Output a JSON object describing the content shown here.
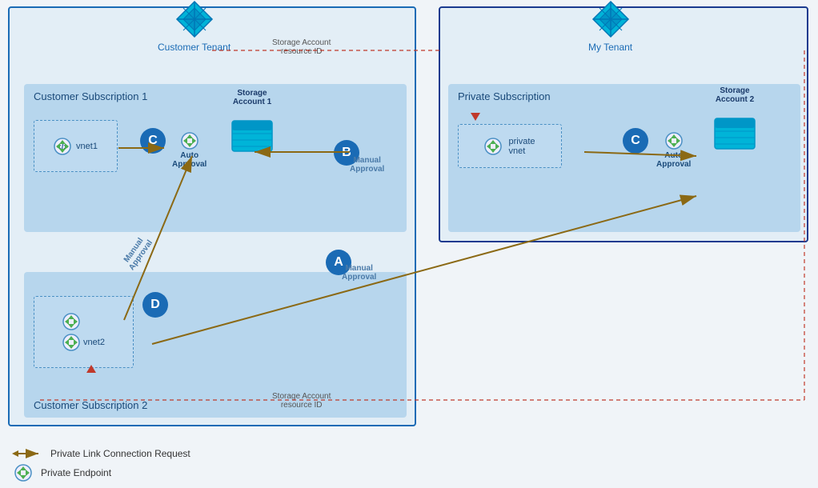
{
  "tenants": {
    "customer": {
      "label": "Customer Tenant",
      "icon": "azure-tenant-icon"
    },
    "my": {
      "label": "My Tenant",
      "icon": "azure-tenant-icon"
    }
  },
  "subscriptions": {
    "cust1": {
      "label": "Customer Subscription 1"
    },
    "cust2": {
      "label": "Customer Subscription 2"
    },
    "private": {
      "label": "Private Subscription"
    }
  },
  "storageAccounts": {
    "sa1": {
      "label": "Storage\nAccount 1"
    },
    "sa2": {
      "label": "Storage\nAccount 2"
    }
  },
  "badges": {
    "A": "A",
    "B": "B",
    "C": "C",
    "D": "D"
  },
  "vnets": {
    "vnet1": {
      "label": "vnet1"
    },
    "vnet2": {
      "label": "vnet2"
    },
    "privateVnet": {
      "label": "private\nvnet"
    }
  },
  "approvals": {
    "manualA": "Manual\nApproval",
    "manualB": "Manual\nApproval",
    "manualD": "Manual\nApproval",
    "autoC1": "Auto\nApproval",
    "autoC2": "Auto\nApproval"
  },
  "resourceIdLabels": {
    "top": "Storage Account\nresource ID",
    "bottom": "Storage Account\nresource ID"
  },
  "legend": {
    "privateLinkLabel": "Private Link Connection Request",
    "privateEndpointLabel": "Private Endpoint"
  }
}
